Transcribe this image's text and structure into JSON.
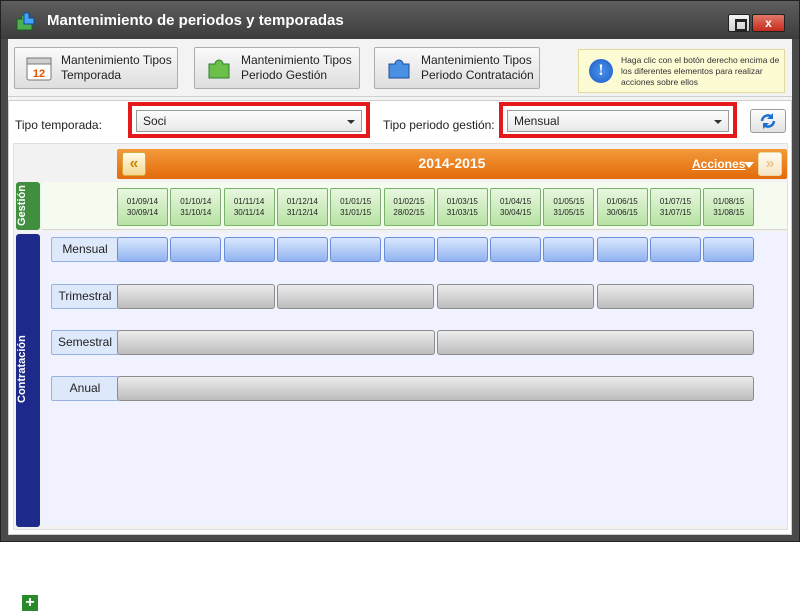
{
  "window": {
    "title": "Mantenimiento de periodos y temporadas",
    "close_label": "x"
  },
  "toolbar": {
    "buttons": [
      {
        "label": "Mantenimiento Tipos\nTemporada",
        "icon": "calendar-icon"
      },
      {
        "label": "Mantenimiento Tipos\nPeriodo Gestión",
        "icon": "green-puzzle-icon"
      },
      {
        "label": "Mantenimiento Tipos\nPeriodo Contratación",
        "icon": "blue-puzzle-icon"
      }
    ],
    "tip": {
      "icon_text": "!",
      "text": "Haga clic con el botón derecho encima de los diferentes elementos para realizar acciones sobre ellos"
    }
  },
  "filters": {
    "temporada_label": "Tipo temporada:",
    "temporada_value": "Soci",
    "periodo_label": "Tipo periodo gestión:",
    "periodo_value": "Mensual"
  },
  "grid": {
    "year": "2014-2015",
    "acciones": "Acciones",
    "prev_label": "«",
    "next_label": "»",
    "gestion_label": "Gestión",
    "contratacion_label": "Contratación",
    "add_label": "+",
    "gestion_cells": [
      {
        "start": "01/09/14",
        "end": "30/09/14"
      },
      {
        "start": "01/10/14",
        "end": "31/10/14"
      },
      {
        "start": "01/11/14",
        "end": "30/11/14"
      },
      {
        "start": "01/12/14",
        "end": "31/12/14"
      },
      {
        "start": "01/01/15",
        "end": "31/01/15"
      },
      {
        "start": "01/02/15",
        "end": "28/02/15"
      },
      {
        "start": "01/03/15",
        "end": "31/03/15"
      },
      {
        "start": "01/04/15",
        "end": "30/04/15"
      },
      {
        "start": "01/05/15",
        "end": "31/05/15"
      },
      {
        "start": "01/06/15",
        "end": "30/06/15"
      },
      {
        "start": "01/07/15",
        "end": "31/07/15"
      },
      {
        "start": "01/08/15",
        "end": "31/08/15"
      }
    ],
    "rows": [
      {
        "label": "Mensual",
        "slots": 12,
        "color": "#91b3f0"
      },
      {
        "label": "Trimestral",
        "slots": 4,
        "color": "#bdbdbd"
      },
      {
        "label": "Semestral",
        "slots": 2,
        "color": "#bdbdbd"
      },
      {
        "label": "Anual",
        "slots": 1,
        "color": "#bdbdbd"
      }
    ]
  },
  "colors": {
    "accent_orange": "#e26a0a",
    "gestion_green": "#3f8f3f",
    "contratacion_navy": "#1d2a8c",
    "highlight_red": "#e3191b"
  }
}
